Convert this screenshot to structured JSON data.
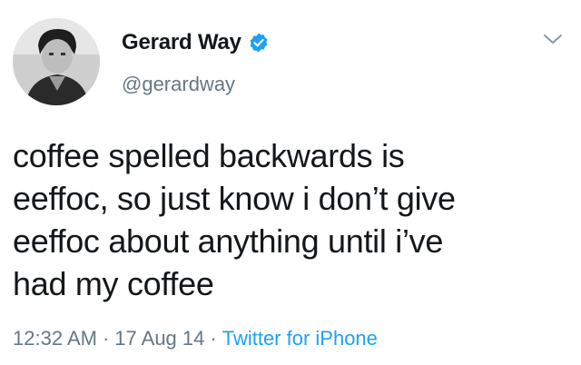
{
  "user": {
    "display_name": "Gerard Way",
    "handle": "@gerardway",
    "verified": true,
    "verified_color": "#1da1f2"
  },
  "tweet": {
    "lines": [
      "coffee spelled backwards is",
      "eeffoc, so just know i don’t give",
      "eeffoc about anything until i’ve",
      "had my coffee"
    ],
    "time": "12:32 AM",
    "date": "17 Aug 14",
    "separator": "·",
    "source": "Twitter for iPhone"
  },
  "icons": {
    "verified": "verified-badge-icon",
    "menu": "chevron-down-icon"
  },
  "colors": {
    "text": "#14171a",
    "secondary": "#657786",
    "link": "#1da1f2"
  }
}
